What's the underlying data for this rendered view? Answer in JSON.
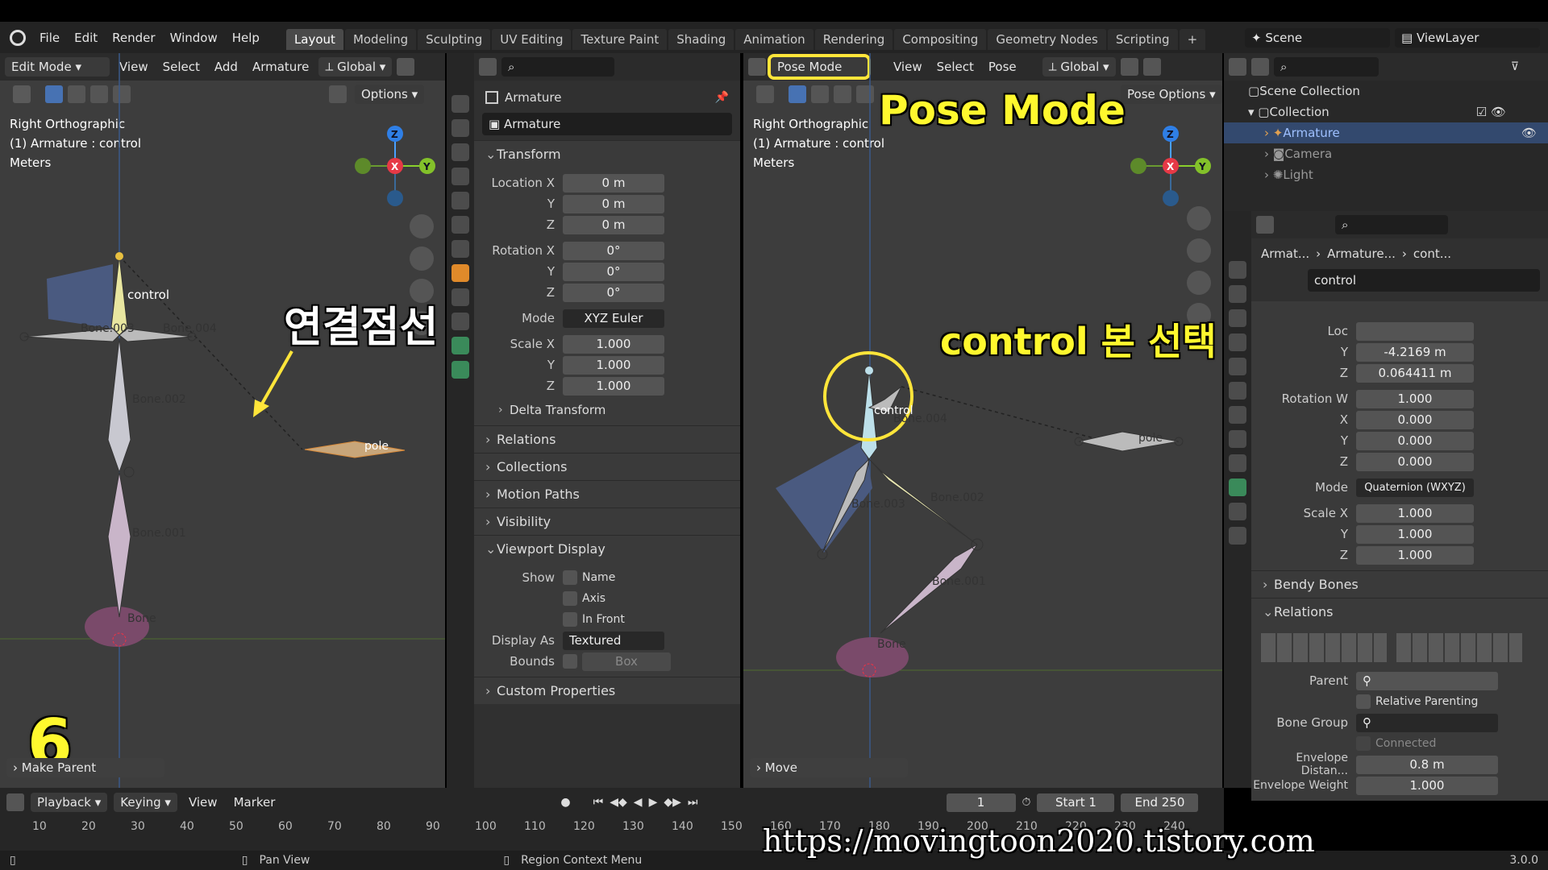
{
  "menubar": {
    "items": [
      "File",
      "Edit",
      "Render",
      "Window",
      "Help"
    ],
    "workspaces": [
      "Layout",
      "Modeling",
      "Sculpting",
      "UV Editing",
      "Texture Paint",
      "Shading",
      "Animation",
      "Rendering",
      "Compositing",
      "Geometry Nodes",
      "Scripting"
    ],
    "active_workspace": "Layout",
    "scene": "Scene",
    "view_layer": "ViewLayer"
  },
  "left_viewport": {
    "mode": "Edit Mode",
    "menus": [
      "View",
      "Select",
      "Add",
      "Armature"
    ],
    "orientation": "Global",
    "options": "Options",
    "view_name": "Right Orthographic",
    "object": "(1) Armature : control",
    "units": "Meters",
    "bones": [
      "control",
      "Bone.003",
      "Bone.004",
      "Bone.002",
      "Bone.001",
      "Bone",
      "pole"
    ],
    "last_op": "Make Parent",
    "step_number": "6",
    "caption": "연결점선"
  },
  "middle_props": {
    "object_name": "Armature",
    "data_name": "Armature",
    "transform_title": "Transform",
    "location_x_label": "Location X",
    "location_x": "0 m",
    "location_y": "0 m",
    "location_z": "0 m",
    "rotation_x_label": "Rotation X",
    "rotation_x": "0°",
    "rotation_y": "0°",
    "rotation_z": "0°",
    "mode_label": "Mode",
    "mode": "XYZ Euler",
    "scale_x_label": "Scale X",
    "scale_x": "1.000",
    "scale_y": "1.000",
    "scale_z": "1.000",
    "y_label": "Y",
    "z_label": "Z",
    "sections": [
      "Delta Transform",
      "Relations",
      "Collections",
      "Motion Paths",
      "Visibility"
    ],
    "viewport_display": "Viewport Display",
    "show_label": "Show",
    "show_name": "Name",
    "show_axis": "Axis",
    "show_in_front": "In Front",
    "display_as_label": "Display As",
    "display_as": "Textured",
    "bounds_label": "Bounds",
    "bounds": "Box",
    "custom_props": "Custom Properties"
  },
  "right_viewport": {
    "mode": "Pose Mode",
    "menus": [
      "View",
      "Select",
      "Pose"
    ],
    "orientation": "Global",
    "options": "Pose Options",
    "view_name": "Right Orthographic",
    "object": "(1) Armature : control",
    "units": "Meters",
    "bones": [
      "control",
      "Bone.004",
      "Bone.003",
      "Bone.002",
      "Bone.001",
      "Bone",
      "pole"
    ],
    "last_op": "Move",
    "caption_mode": "Pose Mode",
    "caption_instruction": "control 본 선택 후 조종한다"
  },
  "outliner": {
    "scene_collection": "Scene Collection",
    "collection": "Collection",
    "items": [
      "Armature",
      "Camera",
      "Light"
    ]
  },
  "bone_props": {
    "breadcrumb": [
      "Armat...",
      "Armature...",
      "cont..."
    ],
    "bone_name": "control",
    "loc_label": "Loc",
    "loc_y": "-4.2169 m",
    "loc_z": "0.064411 m",
    "rotation_w_label": "Rotation W",
    "rotation_w": "1.000",
    "rot_x": "0.000",
    "rot_y": "0.000",
    "rot_z": "0.000",
    "x_label": "X",
    "y_label": "Y",
    "z_label": "Z",
    "mode_label": "Mode",
    "mode": "Quaternion (WXYZ)",
    "scale_x_label": "Scale X",
    "scale_x": "1.000",
    "scale_y": "1.000",
    "scale_z": "1.000",
    "bendy_bones": "Bendy Bones",
    "relations": "Relations",
    "parent_label": "Parent",
    "relative_parenting": "Relative Parenting",
    "bone_group_label": "Bone Group",
    "connected": "Connected",
    "envelope_distance_label": "Envelope Distan...",
    "envelope_distance": "0.8 m",
    "envelope_weight_label": "Envelope Weight",
    "envelope_weight": "1.000"
  },
  "timeline": {
    "menus": [
      "Playback",
      "Keying",
      "View",
      "Marker"
    ],
    "current_frame": "1",
    "start_label": "Start",
    "start": "1",
    "end_label": "End",
    "end": "250",
    "ticks": [
      "10",
      "20",
      "30",
      "40",
      "50",
      "60",
      "70",
      "80",
      "90",
      "100",
      "110",
      "120",
      "130",
      "140",
      "150",
      "160",
      "170",
      "180",
      "190",
      "200",
      "210",
      "220",
      "230",
      "240"
    ]
  },
  "statusbar": {
    "pan_view": "Pan View",
    "context_menu": "Region Context Menu",
    "version": "3.0.0"
  },
  "watermark": "https://movingtoon2020.tistory.com"
}
